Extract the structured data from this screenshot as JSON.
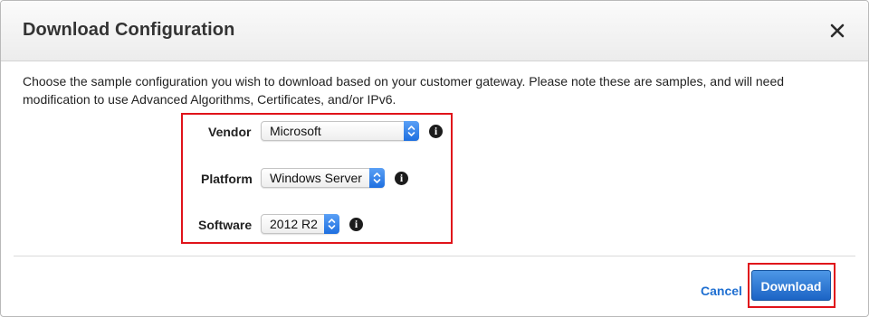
{
  "dialog": {
    "title": "Download Configuration",
    "close_icon": "close-icon",
    "description": "Choose the sample configuration you wish to download based on your customer gateway. Please note these are samples, and will need modification to use Advanced Algorithms, Certificates, and/or IPv6."
  },
  "form": {
    "vendor": {
      "label": "Vendor",
      "value": "Microsoft",
      "info_icon": "info-icon"
    },
    "platform": {
      "label": "Platform",
      "value": "Windows Server",
      "info_icon": "info-icon"
    },
    "software": {
      "label": "Software",
      "value": "2012 R2",
      "info_icon": "info-icon"
    }
  },
  "footer": {
    "cancel_label": "Cancel",
    "download_label": "Download"
  },
  "colors": {
    "accent": "#1f6fd1",
    "primary_button": "#1c64c5",
    "highlight_outline": "#e0131a"
  }
}
